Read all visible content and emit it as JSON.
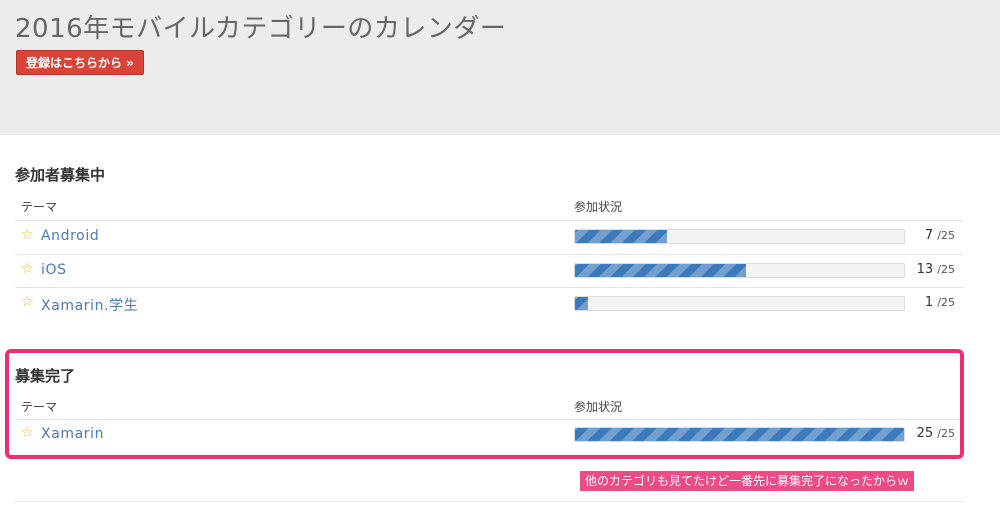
{
  "hero": {
    "title": "2016年モバイルカテゴリーのカレンダー",
    "register_label": "登録はこちらから »"
  },
  "sections": [
    {
      "title": "参加者募集中",
      "col_theme": "テーマ",
      "col_status": "参加状況",
      "rows": [
        {
          "name": "Android",
          "count": "7",
          "total": "/25",
          "fill": 0.28
        },
        {
          "name": "iOS",
          "count": "13",
          "total": "/25",
          "fill": 0.52
        },
        {
          "name": "Xamarin.学生",
          "count": "1",
          "total": "/25",
          "fill": 0.04
        }
      ]
    },
    {
      "title": "募集完了",
      "col_theme": "テーマ",
      "col_status": "参加状況",
      "rows": [
        {
          "name": "Xamarin",
          "count": "25",
          "total": "/25",
          "fill": 1.0
        }
      ]
    }
  ],
  "annotation": {
    "note": "他のカテゴリも見てたけど一番先に募集完了になったからｗ",
    "color": "#ef2d73"
  },
  "icons": {
    "star": "star-outline-icon"
  },
  "colors": {
    "bar": "#3d7abb",
    "register": "#d9433a",
    "link": "#4a7ab8"
  }
}
